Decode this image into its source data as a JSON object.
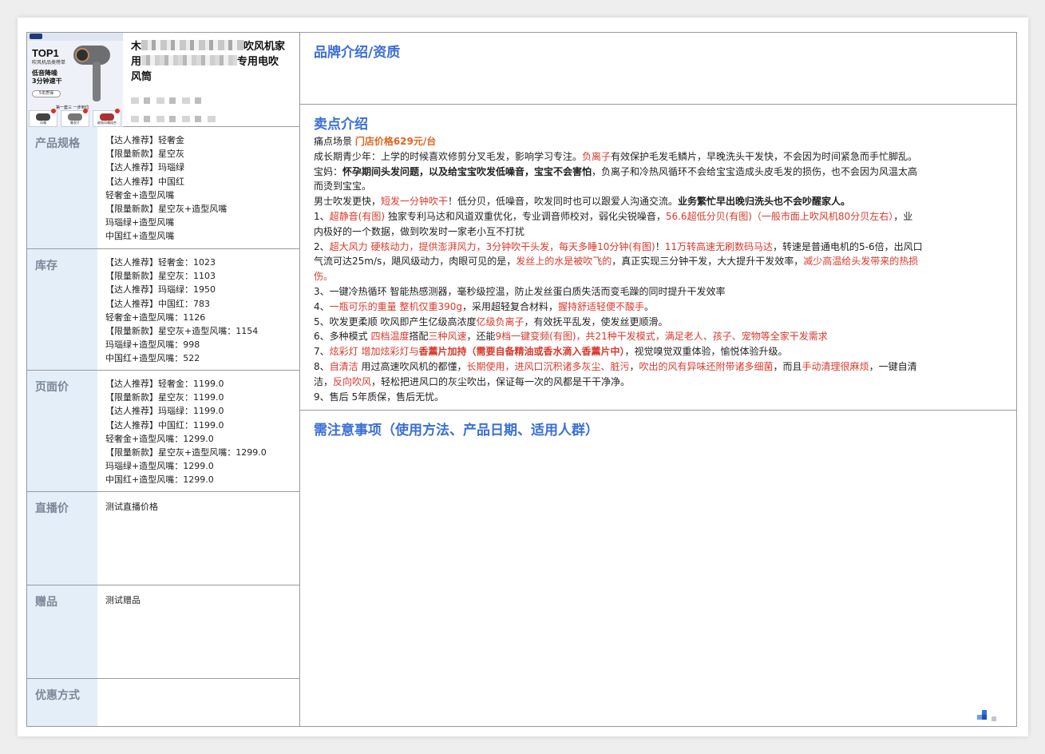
{
  "product": {
    "title_visible_1": "吹风机家",
    "title_prefix_1": "木",
    "title_prefix_2": "用",
    "title_visible_2": "专用电吹",
    "title_visible_3": "风筒",
    "image": {
      "top1": "TOP1",
      "line_a": "吹风机品类榜单",
      "line_b": "低音降噪",
      "line_c": "3分钟速干",
      "pill": "5年质保",
      "caption": "第一套三 一步到位",
      "thumbs": [
        "风嘴",
        "集发片",
        "磁吸风嘴组合"
      ]
    }
  },
  "specs": [
    {
      "label": "产品规格",
      "lines": [
        "【达人推荐】轻奢金",
        "【限量新款】星空灰",
        "【达人推荐】玛瑙绿",
        "【达人推荐】中国红",
        "轻奢金+造型风嘴",
        "【限量新款】星空灰+造型风嘴",
        "玛瑙绿+造型风嘴",
        "中国红+造型风嘴"
      ]
    },
    {
      "label": "库存",
      "lines": [
        "【达人推荐】轻奢金：1023",
        "【限量新款】星空灰：1103",
        "【达人推荐】玛瑙绿：1950",
        "【达人推荐】中国红：783",
        "轻奢金+造型风嘴：1126",
        "【限量新款】星空灰+造型风嘴：1154",
        "玛瑙绿+造型风嘴：998",
        "中国红+造型风嘴：522"
      ]
    },
    {
      "label": "页面价",
      "lines": [
        "【达人推荐】轻奢金：1199.0",
        "【限量新款】星空灰：1199.0",
        "【达人推荐】玛瑙绿：1199.0",
        "【达人推荐】中国红：1199.0",
        "轻奢金+造型风嘴：1299.0",
        "【限量新款】星空灰+造型风嘴：1299.0",
        "玛瑙绿+造型风嘴：1299.0",
        "中国红+造型风嘴：1299.0"
      ]
    },
    {
      "label": "直播价",
      "lines": [
        "测试直播价格"
      ]
    },
    {
      "label": "赠品",
      "lines": [
        "测试赠品"
      ]
    },
    {
      "label": "优惠方式",
      "lines": []
    }
  ],
  "sections": {
    "brand": {
      "title": "品牌介绍/资质"
    },
    "selling": {
      "title": "卖点介绍",
      "scene_label": "痛点场景 ",
      "store_price": "门店价格629元/台",
      "l1a": "成长期青少年：上学的时候喜欢修剪分叉毛发，影响学习专注。",
      "l1b": "负离子",
      "l1c": "有效保护毛发毛鳞片，早晚洗头干发快，不会因为时间紧急而手忙脚乱。",
      "l2a": "宝妈：",
      "l2b": "怀孕期间头发问题，以及给宝宝吹发低噪音，宝宝不会害怕",
      "l2c": "，负离子和冷热风循环不会给宝宝造成头皮毛发的损伤，也不会因为风温太高",
      "l3": "而烫到宝宝。",
      "l4a": "男士吹发更快，",
      "l4b": "短发一分钟吹干",
      "l4c": "！低分贝，低噪音，吹发同时也可以跟爱人沟通交流。",
      "l4d": "业务繁忙早出晚归洗头也不会吵醒家人。",
      "l5a": "1、",
      "l5b": "超静音(有图)",
      "l5c": " 独家专利马达和风道双重优化，专业调音师校对，弱化尖锐噪音，",
      "l5d": "56.6超低分贝(有图)（一般市面上吹风机80分贝左右）",
      "l5e": "，业",
      "l6": "内极好的一个数据，做到吹发时一家老小互不打扰",
      "l7a": "2、",
      "l7b": "超大风力 硬核动力，提供澎湃风力，3分钟吹干头发，每天多睡10分钟(有图)",
      "l7c": "！",
      "l7d": "11万转高速无刷数码马达",
      "l7e": "，转速是普通电机的5-6倍，出风口",
      "l8a": "气流可达25m/s，飓风级动力，肉眼可见的是，",
      "l8b": "发丝上的水是被吹飞的",
      "l8c": "，真正实现三分钟干发，大大提升干发效率，",
      "l8d": "减少高温给头发带来的热损",
      "l9": "伤。",
      "l10": "3、一键冷热循环 智能热感测器，毫秒级控温，防止发丝蛋白质失活而变毛躁的同时提升干发效率",
      "l11a": "4、",
      "l11b": "一瓶可乐的重量 整机仅重390g",
      "l11c": "，采用超轻复合材料，",
      "l11d": "握持舒适轻便不酸手",
      "l11e": "。",
      "l12a": "5、吹发更柔顺 吹风即产生亿级高浓度",
      "l12b": "亿级负离子",
      "l12c": "，有效抚平乱发，使发丝更顺滑。",
      "l13a": "6、多种模式 ",
      "l13b": "四档温度",
      "l13c": "搭配",
      "l13d": "三种风速",
      "l13e": "，还能",
      "l13f": "9档一键变频(有图)，共21种干发模式，满足老人、孩子、宠物等全家干发需求",
      "l14a": "7、",
      "l14b": "炫彩灯 增加炫彩灯与",
      "l14c": "香薰片加持（需要自备精油或香水滴入香薰片中）",
      "l14d": "，视觉嗅觉双重体验，愉悦体验升级。",
      "l15a": "8、",
      "l15b": "自清洁",
      "l15c": " 用过高速吹风机的都懂，",
      "l15d": "长期使用，进风口沉积诸多灰尘、脏污",
      "l15e": "，",
      "l15f": "吹出的风有异味还附带诸多细菌",
      "l15g": "，而且",
      "l15h": "手动清理很麻烦",
      "l15i": "，一键自清",
      "l16a": "洁，",
      "l16b": "反向吹风",
      "l16c": "，轻松把进风口的灰尘吹出，保证每一次的风都是干干净净。",
      "l17": "9、售后 5年质保，售后无忧。"
    },
    "notes": {
      "title": "需注意事项（使用方法、产品日期、适用人群）"
    }
  }
}
